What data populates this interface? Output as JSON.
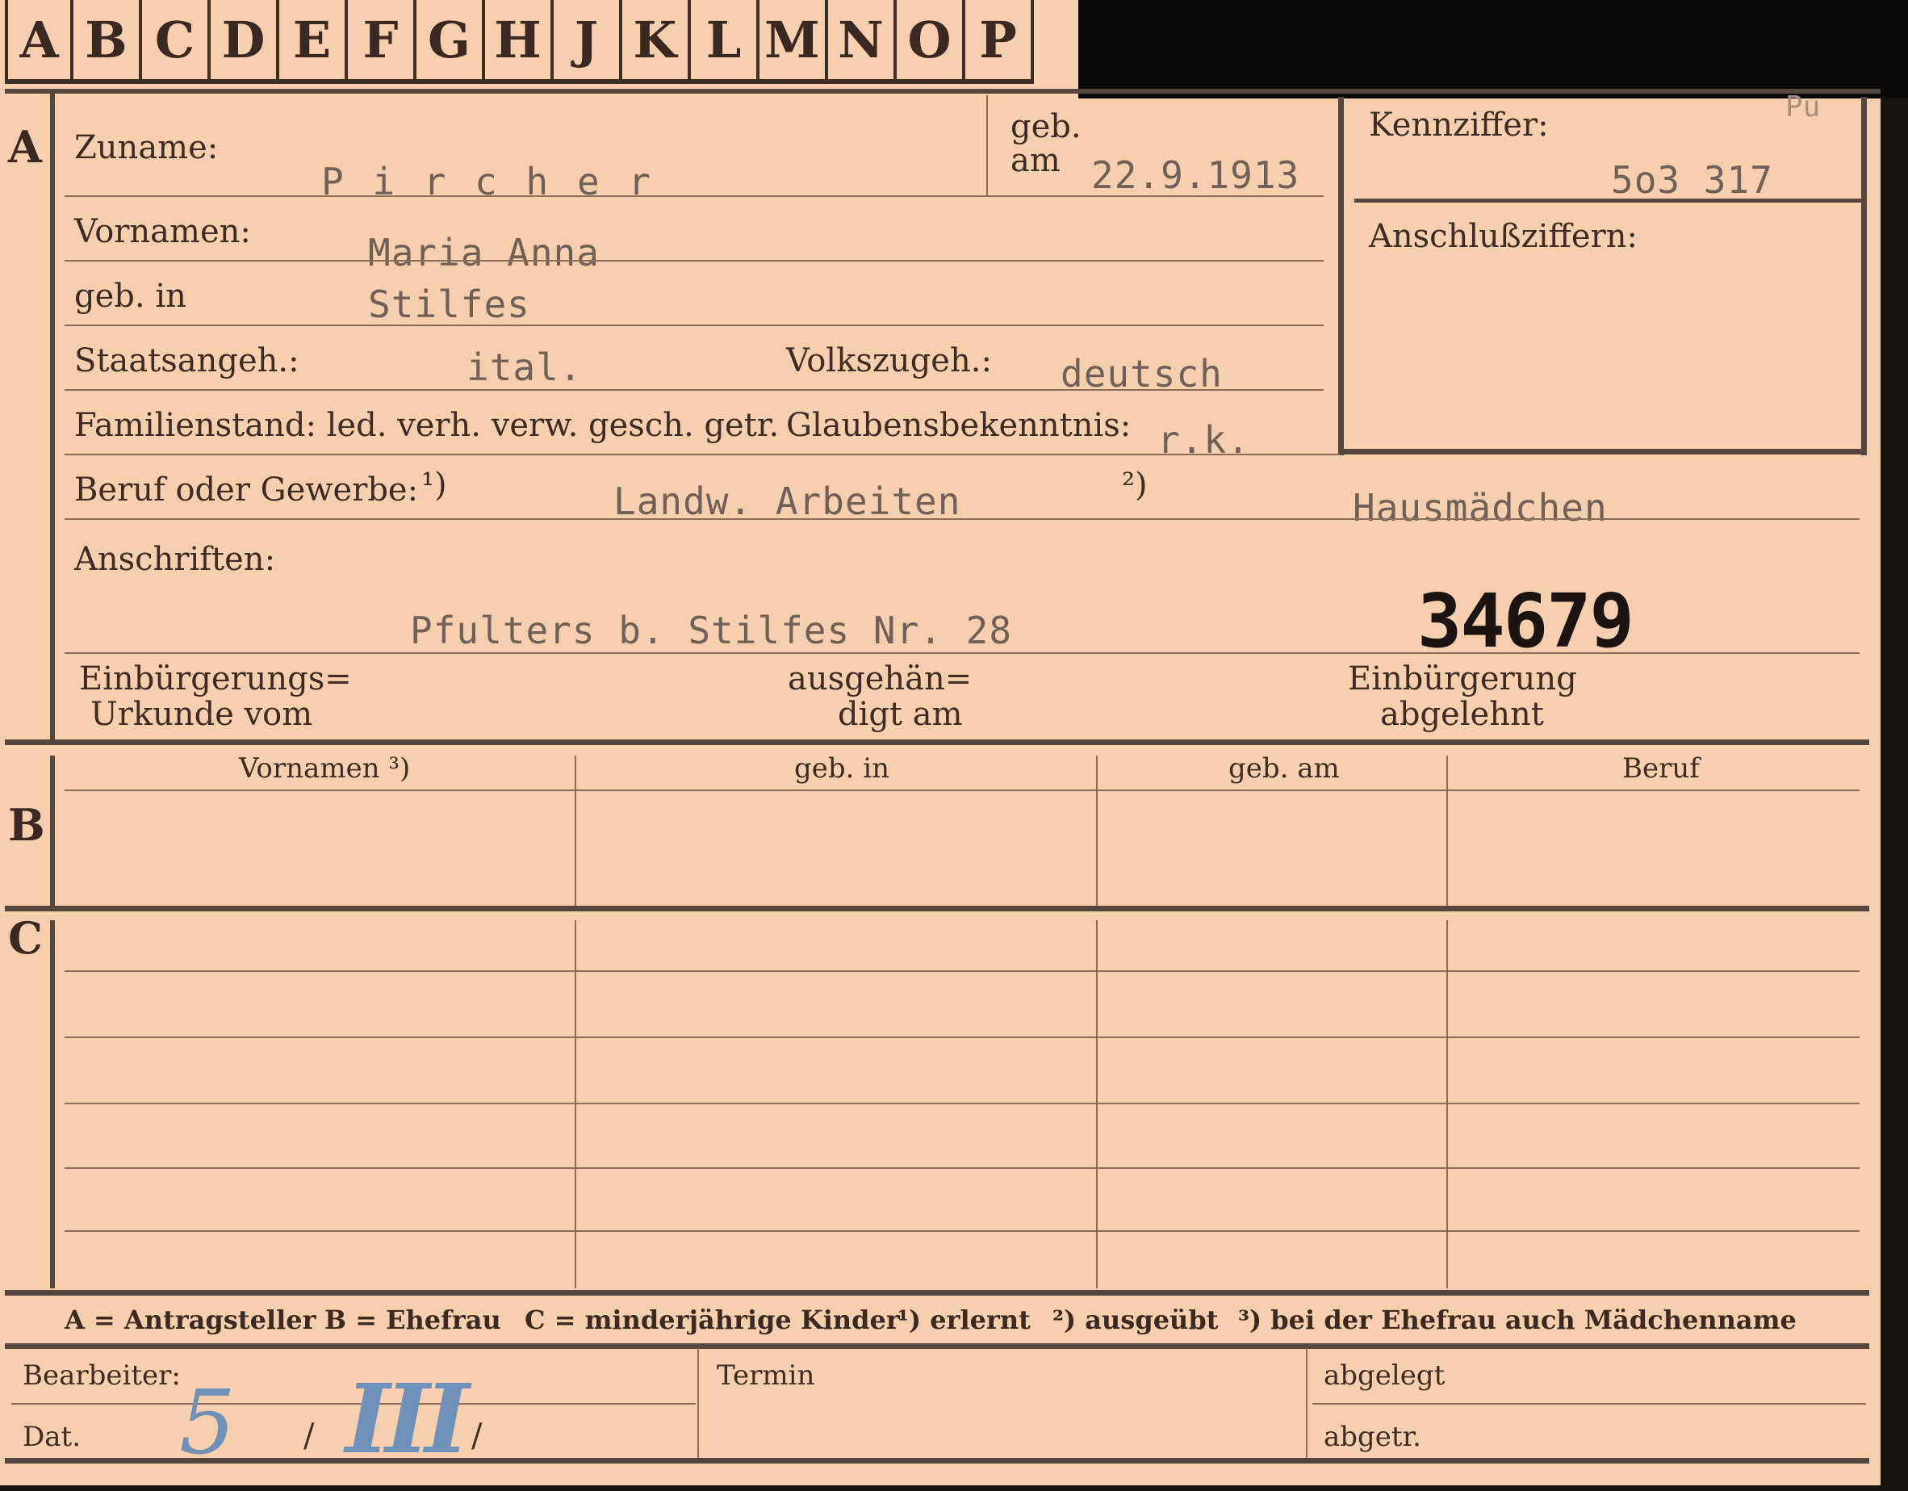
{
  "tabs": [
    "A",
    "B",
    "C",
    "D",
    "E",
    "F",
    "G",
    "H",
    "J",
    "K",
    "L",
    "M",
    "N",
    "O",
    "P"
  ],
  "sections": {
    "a": "A",
    "b": "B",
    "c": "C"
  },
  "fields": {
    "zuname_label": "Zuname:",
    "zuname_value": "P i r c h e r",
    "geb_label": "geb.",
    "am_label": "am",
    "geb_am_value": "22.9.1913",
    "kennziffer_label": "Kennziffer:",
    "kennziffer_note": "Pu",
    "kennziffer_value": "5o3 317",
    "anschluss_label": "Anschlußziffern:",
    "vornamen_label": "Vornamen:",
    "vornamen_value": "Maria Anna",
    "geb_in_label": "geb. in",
    "geb_in_value": "Stilfes",
    "staatsangeh_label": "Staatsangeh.:",
    "staatsangeh_value": "ital.",
    "volkszugeh_label": "Volkszugeh.:",
    "volkszugeh_value": "deutsch",
    "familienstand_label": "Familienstand: led. verh. verw. gesch. getr.",
    "glaubens_label": "Glaubensbekenntnis:",
    "glaubens_value": "r.k.",
    "beruf_label": "Beruf oder Gewerbe:",
    "beruf_mark1": "¹)",
    "beruf_value1": "Landw. Arbeiten",
    "beruf_mark2": "²)",
    "beruf_value2": "Hausmädchen",
    "anschriften_label": "Anschriften:",
    "anschriften_value": "Pfulters b. Stilfes Nr. 28",
    "stamp_number": "34679",
    "einb_urkunde_l1": "Einbürgerungs=",
    "einb_urkunde_l2": "Urkunde vom",
    "ausgeh_l1": "ausgehän=",
    "ausgeh_l2": "digt am",
    "einb_abgelehnt_l1": "Einbürgerung",
    "einb_abgelehnt_l2": "abgelehnt"
  },
  "table_b_headers": [
    "Vornamen ³)",
    "geb. in",
    "geb. am",
    "Beruf"
  ],
  "legend": {
    "a": "A = Antragsteller",
    "b": "B = Ehefrau",
    "c": "C = minderjährige Kinder",
    "n1": "¹) erlernt",
    "n2": "²) ausgeübt",
    "n3": "³) bei der Ehefrau auch Mädchenname"
  },
  "footer": {
    "bearbeiter_label": "Bearbeiter:",
    "dat_label": "Dat.",
    "dat_day": "5",
    "sep1": "/",
    "dat_month": "III",
    "sep2": "/",
    "termin_label": "Termin",
    "abgelegt_label": "abgelegt",
    "abgetr_label": "abgetr."
  }
}
